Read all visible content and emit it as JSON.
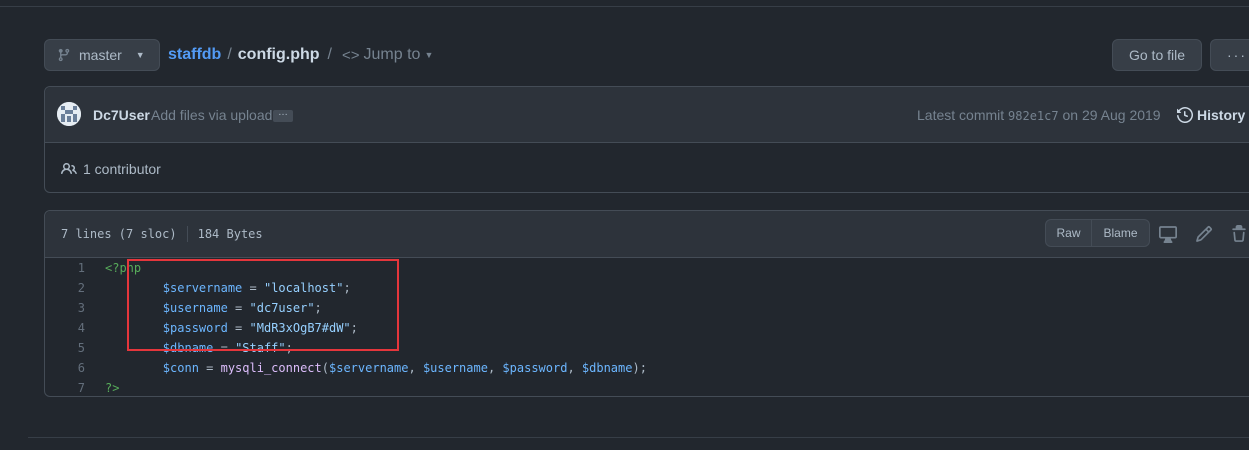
{
  "branch": {
    "label": "master"
  },
  "breadcrumb": {
    "repo": "staffdb",
    "separator": "/",
    "file": "config.php",
    "separator2": "/",
    "jump_to": "Jump to"
  },
  "actions": {
    "go_to_file": "Go to file",
    "more": "···"
  },
  "commit": {
    "author": "Dc7User",
    "message": "Add files via upload",
    "more": "…",
    "latest_label": "Latest commit",
    "sha": "982e1c7",
    "date_text": "on 29 Aug 2019",
    "history": "History"
  },
  "contributors": {
    "label": "1 contributor"
  },
  "file": {
    "lines": "7 lines (7 sloc)",
    "size": "184 Bytes",
    "raw": "Raw",
    "blame": "Blame"
  },
  "icons": {
    "branch": "git-branch-icon",
    "code": "code-icon",
    "history": "history-icon",
    "people": "people-icon",
    "desktop": "desktop-icon",
    "edit": "pencil-icon",
    "delete": "trash-icon"
  },
  "code_lines": [
    {
      "num": "1",
      "tokens": [
        {
          "t": "<?php",
          "k": "php"
        }
      ]
    },
    {
      "num": "2",
      "tokens": [
        {
          "t": "        ",
          "k": ""
        },
        {
          "t": "$servername",
          "k": "var"
        },
        {
          "t": " = ",
          "k": ""
        },
        {
          "t": "\"localhost\"",
          "k": "str"
        },
        {
          "t": ";",
          "k": ""
        }
      ]
    },
    {
      "num": "3",
      "tokens": [
        {
          "t": "        ",
          "k": ""
        },
        {
          "t": "$username",
          "k": "var"
        },
        {
          "t": " = ",
          "k": ""
        },
        {
          "t": "\"dc7user\"",
          "k": "str"
        },
        {
          "t": ";",
          "k": ""
        }
      ]
    },
    {
      "num": "4",
      "tokens": [
        {
          "t": "        ",
          "k": ""
        },
        {
          "t": "$password",
          "k": "var"
        },
        {
          "t": " = ",
          "k": ""
        },
        {
          "t": "\"MdR3xOgB7#dW\"",
          "k": "str"
        },
        {
          "t": ";",
          "k": ""
        }
      ]
    },
    {
      "num": "5",
      "tokens": [
        {
          "t": "        ",
          "k": ""
        },
        {
          "t": "$dbname",
          "k": "var"
        },
        {
          "t": " = ",
          "k": ""
        },
        {
          "t": "\"Staff\"",
          "k": "str"
        },
        {
          "t": ";",
          "k": ""
        }
      ]
    },
    {
      "num": "6",
      "tokens": [
        {
          "t": "        ",
          "k": ""
        },
        {
          "t": "$conn",
          "k": "var"
        },
        {
          "t": " = ",
          "k": ""
        },
        {
          "t": "mysqli_connect",
          "k": "fn"
        },
        {
          "t": "(",
          "k": ""
        },
        {
          "t": "$servername",
          "k": "var"
        },
        {
          "t": ", ",
          "k": ""
        },
        {
          "t": "$username",
          "k": "var"
        },
        {
          "t": ", ",
          "k": ""
        },
        {
          "t": "$password",
          "k": "var"
        },
        {
          "t": ", ",
          "k": ""
        },
        {
          "t": "$dbname",
          "k": "var"
        },
        {
          "t": ");",
          "k": ""
        }
      ]
    },
    {
      "num": "7",
      "tokens": [
        {
          "t": "?>",
          "k": "php"
        }
      ]
    }
  ],
  "colors": {
    "background": "#22272e",
    "link": "#539bf5",
    "highlight_box": "#e5363c"
  }
}
